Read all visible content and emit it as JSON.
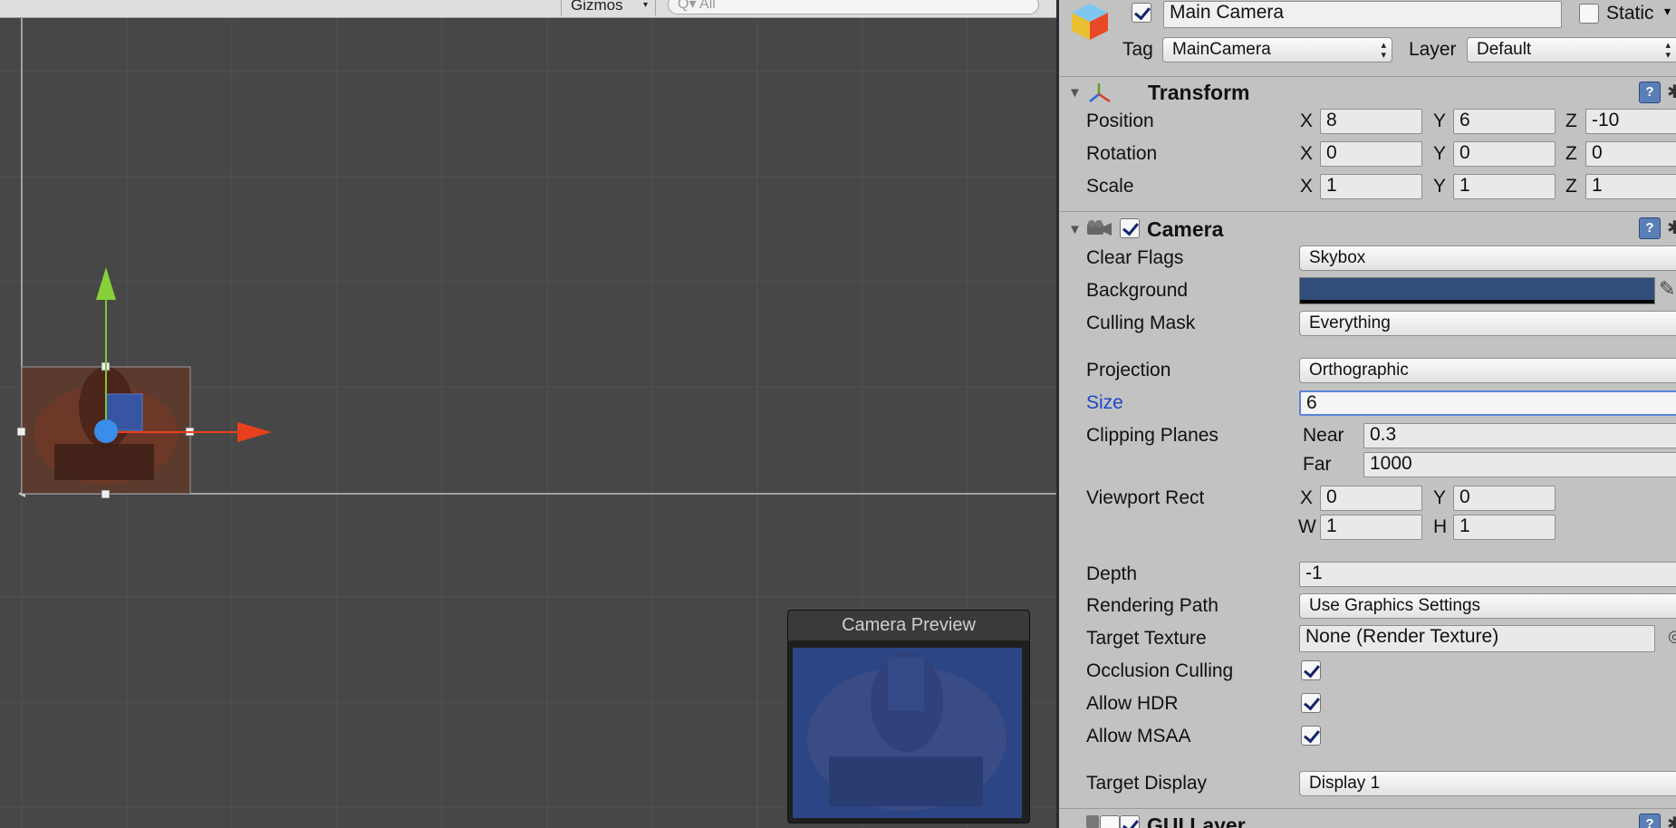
{
  "scene": {
    "toolbar": {
      "gizmos_label": "Gizmos",
      "search_placeholder": "Q▾ All"
    },
    "camera_preview_title": "Camera Preview",
    "colors": {
      "background": "#474747",
      "grid": "#545454",
      "axis_y": "#80c43a",
      "axis_x": "#e8401c",
      "center": "#3a8de8"
    }
  },
  "inspector": {
    "object": {
      "name": "Main Camera",
      "active": true,
      "static_label": "Static",
      "static": false,
      "tag_label": "Tag",
      "tag": "MainCamera",
      "layer_label": "Layer",
      "layer": "Default"
    },
    "transform": {
      "title": "Transform",
      "position_label": "Position",
      "rotation_label": "Rotation",
      "scale_label": "Scale",
      "position": {
        "x": "8",
        "y": "6",
        "z": "-10"
      },
      "rotation": {
        "x": "0",
        "y": "0",
        "z": "0"
      },
      "scale": {
        "x": "1",
        "y": "1",
        "z": "1"
      }
    },
    "camera": {
      "title": "Camera",
      "enabled": true,
      "clear_flags_label": "Clear Flags",
      "clear_flags": "Skybox",
      "background_label": "Background",
      "background_color": "#314d79",
      "culling_mask_label": "Culling Mask",
      "culling_mask": "Everything",
      "projection_label": "Projection",
      "projection": "Orthographic",
      "size_label": "Size",
      "size": "6",
      "clipping_planes_label": "Clipping Planes",
      "near_label": "Near",
      "near": "0.3",
      "far_label": "Far",
      "far": "1000",
      "viewport_rect_label": "Viewport Rect",
      "viewport": {
        "x": "0",
        "y": "0",
        "w": "1",
        "h": "1"
      },
      "depth_label": "Depth",
      "depth": "-1",
      "rendering_path_label": "Rendering Path",
      "rendering_path": "Use Graphics Settings",
      "target_texture_label": "Target Texture",
      "target_texture": "None (Render Texture)",
      "occlusion_culling_label": "Occlusion Culling",
      "occlusion_culling": true,
      "allow_hdr_label": "Allow HDR",
      "allow_hdr": true,
      "allow_msaa_label": "Allow MSAA",
      "allow_msaa": true,
      "target_display_label": "Target Display",
      "target_display": "Display 1"
    },
    "gui_layer": {
      "title": "GUI Layer"
    },
    "axis_letters": {
      "x": "X",
      "y": "Y",
      "z": "Z",
      "w": "W",
      "h": "H"
    }
  }
}
